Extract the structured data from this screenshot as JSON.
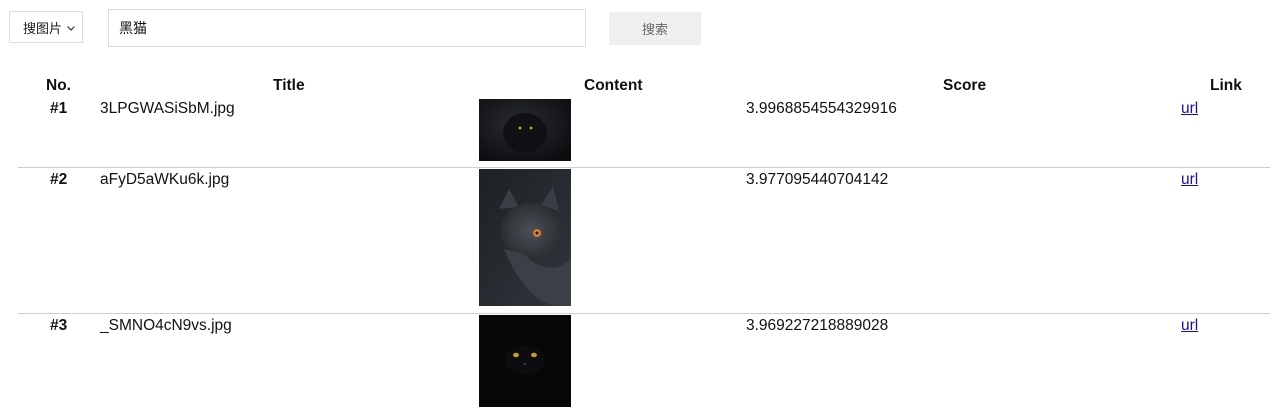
{
  "search": {
    "mode_label": "搜图片",
    "query": "黑猫",
    "button_label": "搜索"
  },
  "table": {
    "headers": {
      "no": "No.",
      "title": "Title",
      "content": "Content",
      "score": "Score",
      "link": "Link"
    },
    "rows": [
      {
        "no": "#1",
        "title": "3LPGWASiSbM.jpg",
        "score": "3.9968854554329916",
        "link": "url",
        "image": "black-cat-in-dark-with-glowing-eyes"
      },
      {
        "no": "#2",
        "title": "aFyD5aWKu6k.jpg",
        "score": "3.977095440704142",
        "link": "url",
        "image": "gray-cat-portrait-with-orange-eye"
      },
      {
        "no": "#3",
        "title": "_SMNO4cN9vs.jpg",
        "score": "3.969227218889028",
        "link": "url",
        "image": "black-cat-eyes-glowing-in-darkness"
      }
    ]
  }
}
